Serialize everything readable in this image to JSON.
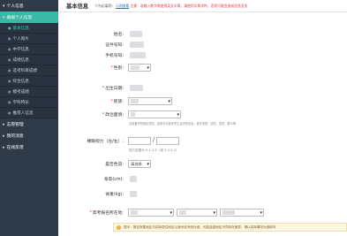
{
  "sidebar": {
    "groups_top": [
      {
        "label": "个人信息"
      },
      {
        "label": "填报个人信息"
      }
    ],
    "items": [
      {
        "label": "基本信息"
      },
      {
        "label": "个人照片"
      },
      {
        "label": "中学信息"
      },
      {
        "label": "成绩信息"
      },
      {
        "label": "选考科目成绩"
      },
      {
        "label": "综合信息"
      },
      {
        "label": "模考成绩"
      },
      {
        "label": "学科特长"
      },
      {
        "label": "推荐人信息"
      }
    ],
    "groups_bottom": [
      {
        "label": "志愿管理"
      },
      {
        "label": "我的消息"
      },
      {
        "label": "在线反馈"
      }
    ]
  },
  "header": {
    "title": "基本信息",
    "note_prefix": "（*为必填项）",
    "note_link": "示例查看",
    "note_red": "注意：若输入数字需使用英文半角，请使用半角字符，否则可能会造成信息丢失"
  },
  "form": {
    "name_label": "姓名:",
    "id_label": "证件号码:",
    "phone_label": "手机号码:",
    "gender_label": "性别:",
    "birth_label": "出生日期:",
    "ethnic_label": "民族:",
    "political_label": "政治面貌:",
    "political_hint": "请准备学校规定须知，如填写请参考学生证内的信息，填写类型：团员、党员、群众等",
    "vision_label": "裸眼视力（左/右）:",
    "vision_slash": "/",
    "vision_hint": "视力范围为 0.1-1.5（或 4.0-5.2）",
    "colorblind_label": "是否色盲:",
    "colorblind_value": "请选择",
    "height_label": "身高(cm):",
    "weight_label": "体重(kg):",
    "region_label": "高考报名所在地:",
    "notice": "提示：报名所属地区与实际居住地区以身份证号码为准，可能会因地区不同存在差异，请以实际情况为准填写"
  },
  "colors": {
    "sidebar_bg": "#2f3a48",
    "accent": "#3bb8a6",
    "required": "#e03a3a",
    "link": "#2d6fd2"
  }
}
